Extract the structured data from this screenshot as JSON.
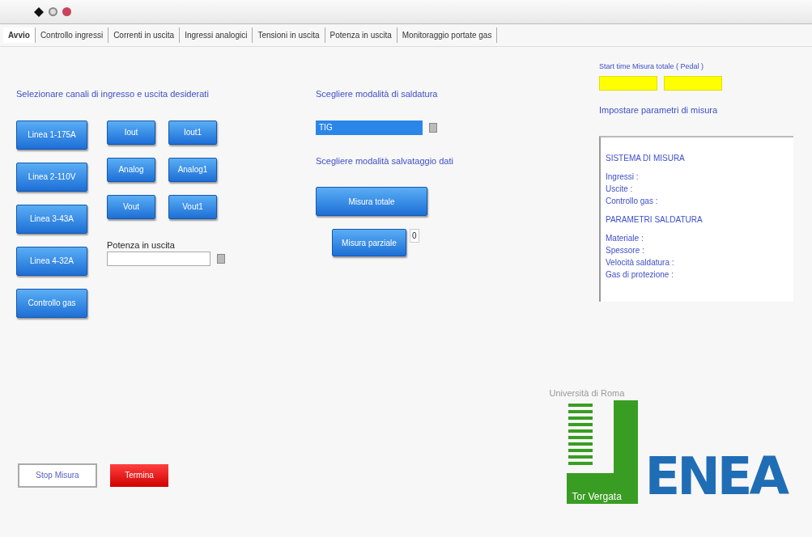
{
  "toolbar": {
    "running": true
  },
  "tabs": [
    {
      "label": "Avvio",
      "selected": true
    },
    {
      "label": "Controllo ingressi",
      "selected": false
    },
    {
      "label": "Correnti in uscita",
      "selected": false
    },
    {
      "label": "Ingressi analogici",
      "selected": false
    },
    {
      "label": "Tensioni in uscita",
      "selected": false
    },
    {
      "label": "Potenza in uscita",
      "selected": false
    },
    {
      "label": "Monitoraggio portate gas",
      "selected": false
    }
  ],
  "channels": {
    "heading": "Selezionare canali di ingresso e uscita desiderati",
    "lines": [
      "Linea 1-175A",
      "Linea 2-110V",
      "Linea 3-43A",
      "Linea 4-32A",
      "Controllo gas"
    ],
    "outputs": [
      [
        "Iout",
        "Iout1"
      ],
      [
        "Analog",
        "Analog1"
      ],
      [
        "Vout",
        "Vout1"
      ]
    ],
    "power": {
      "label": "Potenza in uscita"
    }
  },
  "mode": {
    "heading": "Scegliere modalità di saldatura",
    "selected_mode": "TIG",
    "save_heading": "Scegliere modalità salvataggio dati",
    "total_button": "Misura totale",
    "partial_button": "Misura parziale",
    "partial_value": "0"
  },
  "params": {
    "start_label": "Start time Misura totale ( Pedal )",
    "heading": "Impostare parametri di misura",
    "summary": [
      {
        "text": "SISTEMA DI MISURA",
        "kind": "title"
      },
      {
        "text": "Ingressi :",
        "kind": "line"
      },
      {
        "text": "Uscite :",
        "kind": "line"
      },
      {
        "text": "Controllo gas :",
        "kind": "line"
      },
      {
        "text": "PARAMETRI SALDATURA",
        "kind": "title"
      },
      {
        "text": "Materiale :",
        "kind": "line"
      },
      {
        "text": "Spessore :",
        "kind": "line"
      },
      {
        "text": "Velocità saldatura :",
        "kind": "line"
      },
      {
        "text": "Gas di protezione :",
        "kind": "line"
      }
    ]
  },
  "footer": {
    "stop_button": "Stop Misura",
    "red_button": "Termina"
  },
  "logos": {
    "university_top": "Università di Roma",
    "university_bottom": "Tor Vergata",
    "enea": "ENEA"
  }
}
